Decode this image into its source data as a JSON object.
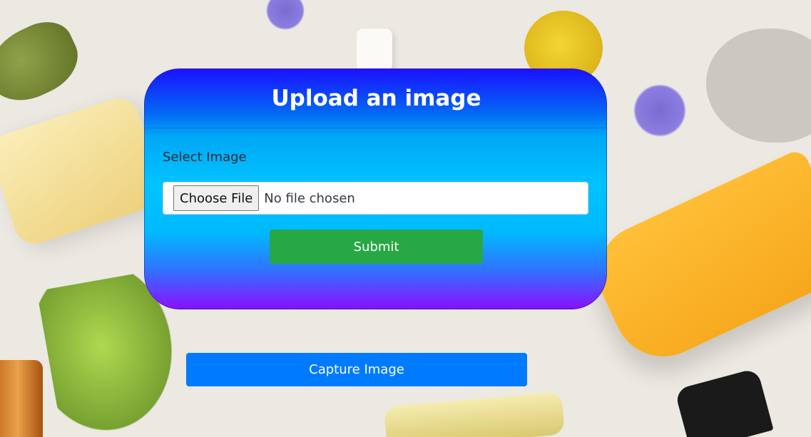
{
  "background": {
    "description_icon": "cosmetics-flatlay-image"
  },
  "upload_card": {
    "title": "Upload an image",
    "select_label": "Select Image",
    "file_input": {
      "button_label": "Choose File",
      "status_text": "No file chosen"
    },
    "submit_label": "Submit"
  },
  "capture_label": "Capture Image",
  "colors": {
    "gradient_top": "#1a12ff",
    "gradient_mid": "#00c3ff",
    "gradient_bottom": "#8a10ff",
    "submit_green": "#28a745",
    "capture_blue": "#007bff"
  }
}
